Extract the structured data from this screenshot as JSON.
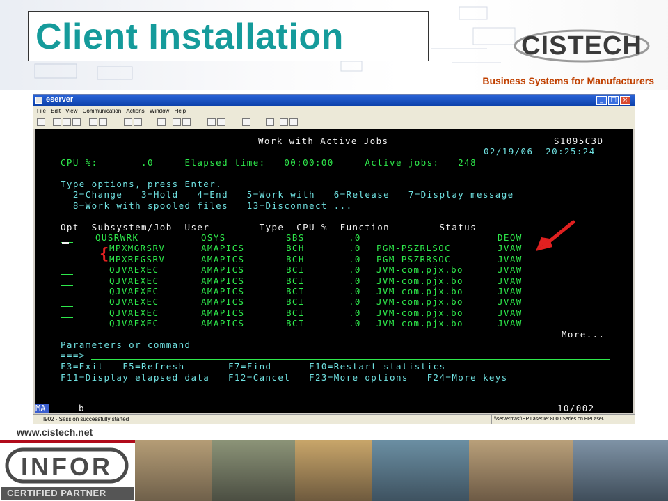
{
  "slide": {
    "title": "Client Installation",
    "logo_text": "CISTECH",
    "tagline": "Business Systems for Manufacturers",
    "url": "www.cistech.net",
    "partner_logo_text": "INFOR",
    "partner_label": "CERTIFIED PARTNER"
  },
  "window": {
    "title": "eserver",
    "menu": [
      "File",
      "Edit",
      "View",
      "Communication",
      "Actions",
      "Window",
      "Help"
    ],
    "controls": [
      "minimize-icon",
      "maximize-icon",
      "close-icon"
    ]
  },
  "terminal": {
    "header_title": "Work with Active Jobs",
    "system_name": "S1095C3D",
    "date_time": "02/19/06  20:25:24",
    "cpu_line": "CPU %:       .0     Elapsed time:   00:00:00     Active jobs:   248",
    "instructions": "Type options, press Enter.",
    "options_line1": "  2=Change   3=Hold   4=End   5=Work with   6=Release   7=Display message",
    "options_line2": "  8=Work with spooled files   13=Disconnect ...",
    "col_headers": "Opt  Subsystem/Job  User        Type  CPU %  Function        Status",
    "rows": [
      {
        "job": "QUSRWRK",
        "indent": false,
        "user": "QSYS",
        "type": "SBS",
        "cpu": ".0",
        "func": "",
        "status": "DEQW"
      },
      {
        "job": "MPXMGRSRV",
        "indent": true,
        "user": "AMAPICS",
        "type": "BCH",
        "cpu": ".0",
        "func": "PGM-PSZRLSOC",
        "status": "JVAW"
      },
      {
        "job": "MPXREGSRV",
        "indent": true,
        "user": "AMAPICS",
        "type": "BCH",
        "cpu": ".0",
        "func": "PGM-PSZRRSOC",
        "status": "JVAW"
      },
      {
        "job": "QJVAEXEC",
        "indent": true,
        "user": "AMAPICS",
        "type": "BCI",
        "cpu": ".0",
        "func": "JVM-com.pjx.bo",
        "status": "JVAW"
      },
      {
        "job": "QJVAEXEC",
        "indent": true,
        "user": "AMAPICS",
        "type": "BCI",
        "cpu": ".0",
        "func": "JVM-com.pjx.bo",
        "status": "JVAW"
      },
      {
        "job": "QJVAEXEC",
        "indent": true,
        "user": "AMAPICS",
        "type": "BCI",
        "cpu": ".0",
        "func": "JVM-com.pjx.bo",
        "status": "JVAW"
      },
      {
        "job": "QJVAEXEC",
        "indent": true,
        "user": "AMAPICS",
        "type": "BCI",
        "cpu": ".0",
        "func": "JVM-com.pjx.bo",
        "status": "JVAW"
      },
      {
        "job": "QJVAEXEC",
        "indent": true,
        "user": "AMAPICS",
        "type": "BCI",
        "cpu": ".0",
        "func": "JVM-com.pjx.bo",
        "status": "JVAW"
      },
      {
        "job": "QJVAEXEC",
        "indent": true,
        "user": "AMAPICS",
        "type": "BCI",
        "cpu": ".0",
        "func": "JVM-com.pjx.bo",
        "status": "JVAW"
      }
    ],
    "more": "More...",
    "params_label": "Parameters or command",
    "prompt": "===>",
    "fkeys_line1": "F3=Exit   F5=Refresh       F7=Find      F10=Restart statistics",
    "fkeys_line2": "F11=Display elapsed data   F12=Cancel   F23=More options   F24=More keys"
  },
  "status": {
    "mode": "MA",
    "field": "b",
    "position": "10/002",
    "session_message": "I902 - Session successfully started",
    "printer": "\\\\servermast\\HP LaserJet 8000 Series on HPLaserJ"
  },
  "colors": {
    "title": "#159b9b",
    "tagline": "#c04000",
    "terminal_green": "#2ee84b",
    "terminal_bg": "#000000",
    "arrow": "#e02020"
  }
}
